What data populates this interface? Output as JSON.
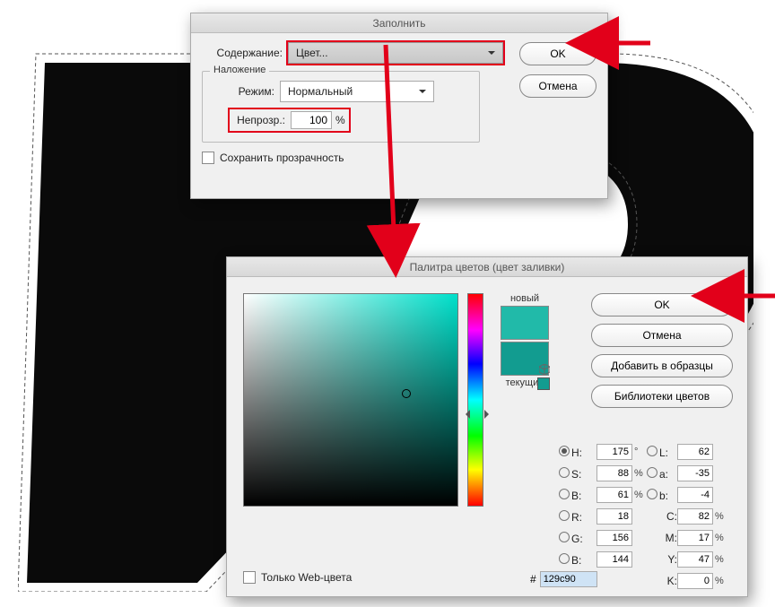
{
  "fill_dialog": {
    "title": "Заполнить",
    "content_label": "Содержание:",
    "content_value": "Цвет...",
    "ok": "OK",
    "cancel": "Отмена",
    "blend_group": "Наложение",
    "mode_label": "Режим:",
    "mode_value": "Нормальный",
    "opacity_label": "Непрозр.:",
    "opacity_value": "100",
    "opacity_unit": "%",
    "preserve_chk": "Сохранить прозрачность"
  },
  "picker": {
    "title": "Палитра цветов (цвет заливки)",
    "new_label": "новый",
    "current_label": "текущий",
    "ok": "OK",
    "cancel": "Отмена",
    "add_swatch": "Добавить в образцы",
    "color_libs": "Библиотеки цветов",
    "web_only": "Только Web-цвета",
    "hex_label": "#",
    "hex_value": "129c90",
    "swatch_new": "#21baa9",
    "swatch_cur": "#129c90",
    "fields": {
      "H": {
        "value": "175",
        "unit": "°"
      },
      "S": {
        "value": "88",
        "unit": "%"
      },
      "Bv": {
        "value": "61",
        "unit": "%"
      },
      "R": {
        "value": "18",
        "unit": ""
      },
      "G": {
        "value": "156",
        "unit": ""
      },
      "Bb": {
        "value": "144",
        "unit": ""
      },
      "L": {
        "value": "62",
        "unit": ""
      },
      "a": {
        "value": "-35",
        "unit": ""
      },
      "b": {
        "value": "-4",
        "unit": ""
      },
      "C": {
        "value": "82",
        "unit": "%"
      },
      "M": {
        "value": "17",
        "unit": "%"
      },
      "Y": {
        "value": "47",
        "unit": "%"
      },
      "K": {
        "value": "0",
        "unit": "%"
      }
    },
    "labels": {
      "H": "H:",
      "S": "S:",
      "Bv": "B:",
      "R": "R:",
      "G": "G:",
      "Bb": "B:",
      "L": "L:",
      "a": "a:",
      "b": "b:",
      "C": "C:",
      "M": "M:",
      "Y": "Y:",
      "K": "K:"
    }
  }
}
